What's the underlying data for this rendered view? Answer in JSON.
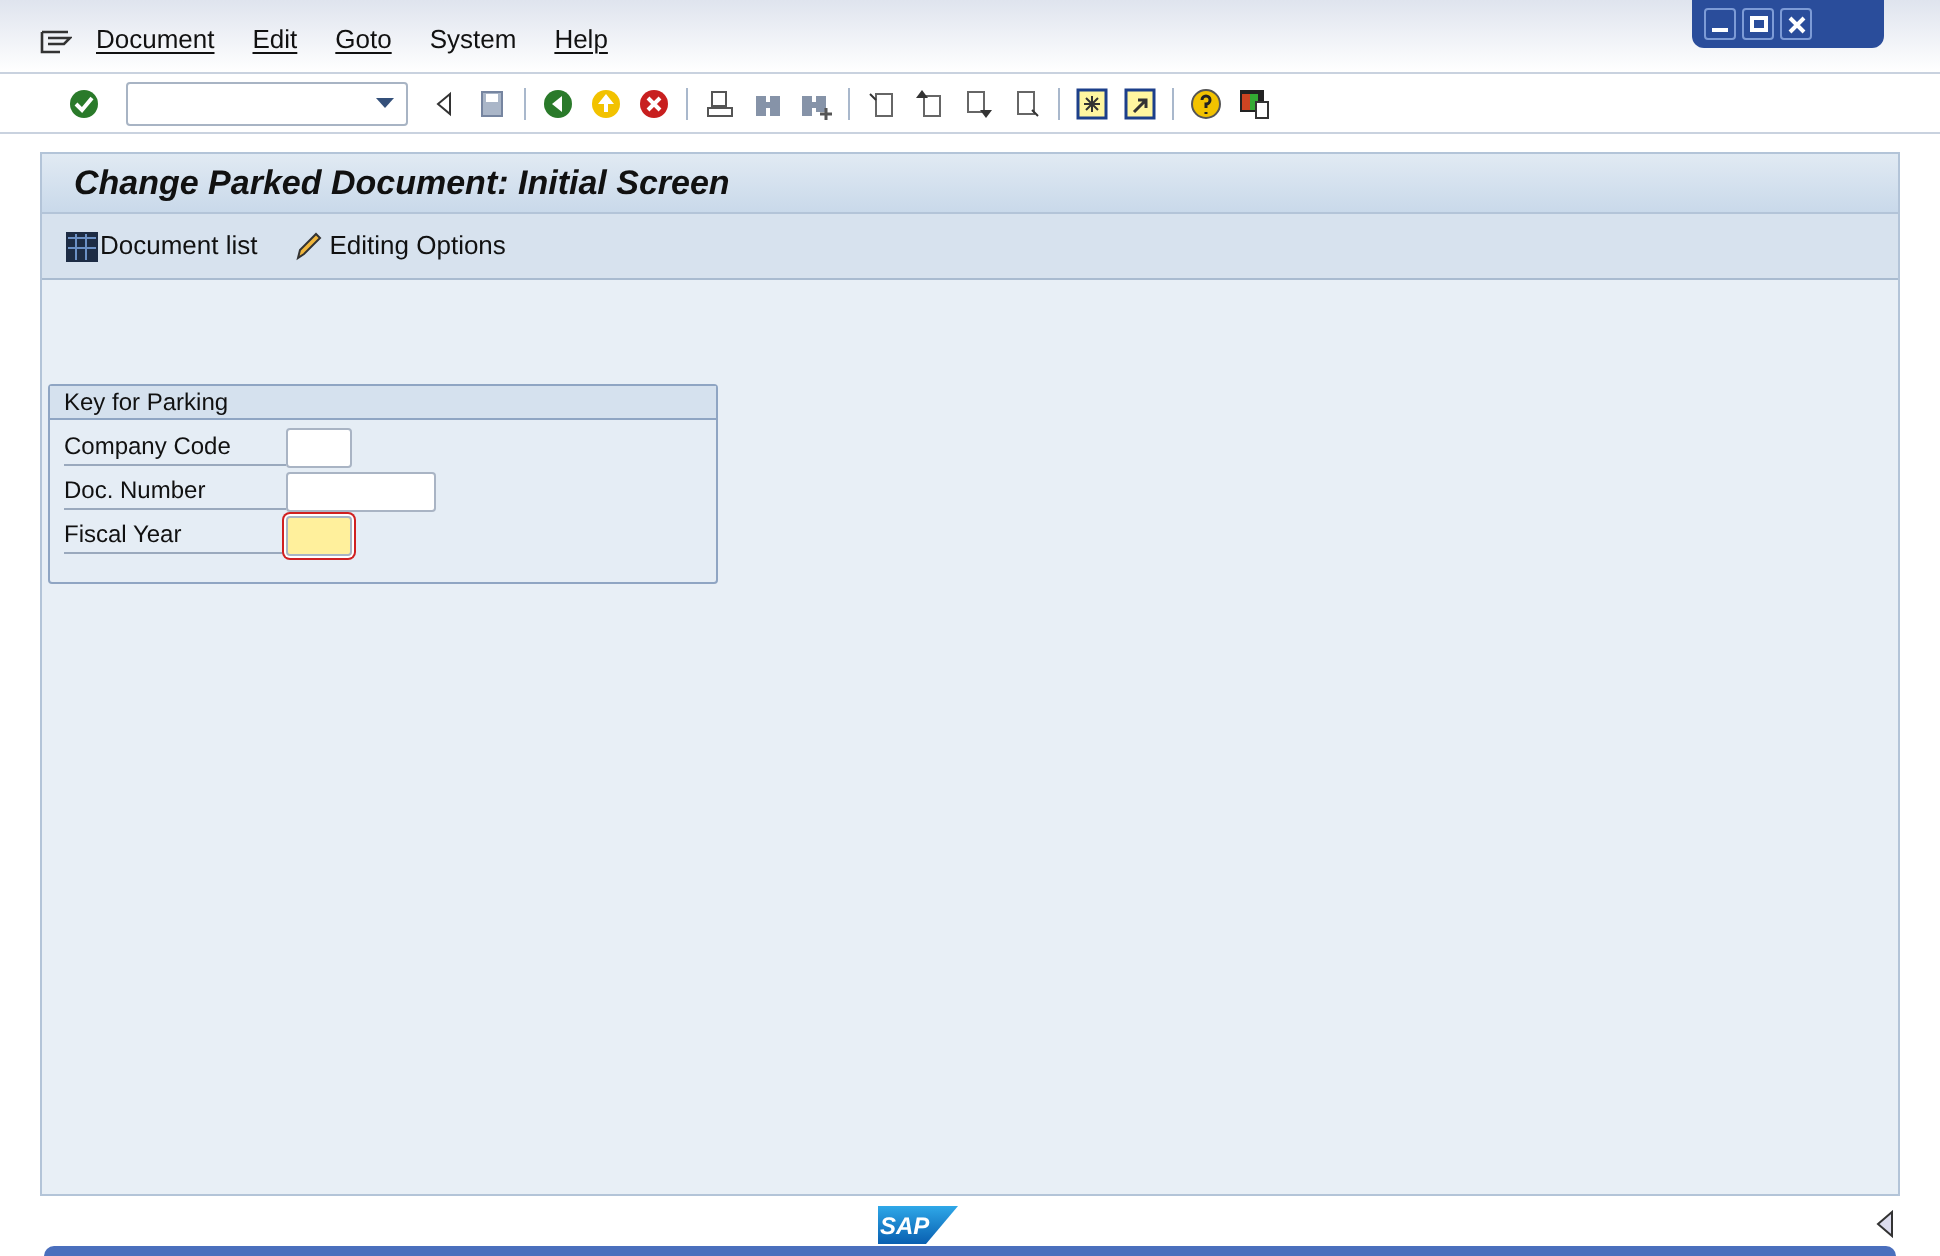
{
  "menu_bar": [
    {
      "label": "Document",
      "underlined": true
    },
    {
      "label": "Edit",
      "underlined": true
    },
    {
      "label": "Goto",
      "underlined": true
    },
    {
      "label": "System",
      "underlined": false
    },
    {
      "label": "Help",
      "underlined": true
    }
  ],
  "title": "Change Parked Document: Initial Screen",
  "app_toolbar": [
    {
      "label": "Document list",
      "kind": "grid"
    },
    {
      "label": "Editing Options",
      "kind": "pencil"
    }
  ],
  "group": {
    "title": "Key for Parking",
    "fields": [
      {
        "label": "Company Code",
        "kind": "short",
        "focused": false
      },
      {
        "label": "Doc. Number",
        "kind": "long",
        "focused": false
      },
      {
        "label": "Fiscal Year",
        "kind": "short",
        "focused": true
      }
    ]
  },
  "footer": {
    "logo_text": "SAP"
  }
}
